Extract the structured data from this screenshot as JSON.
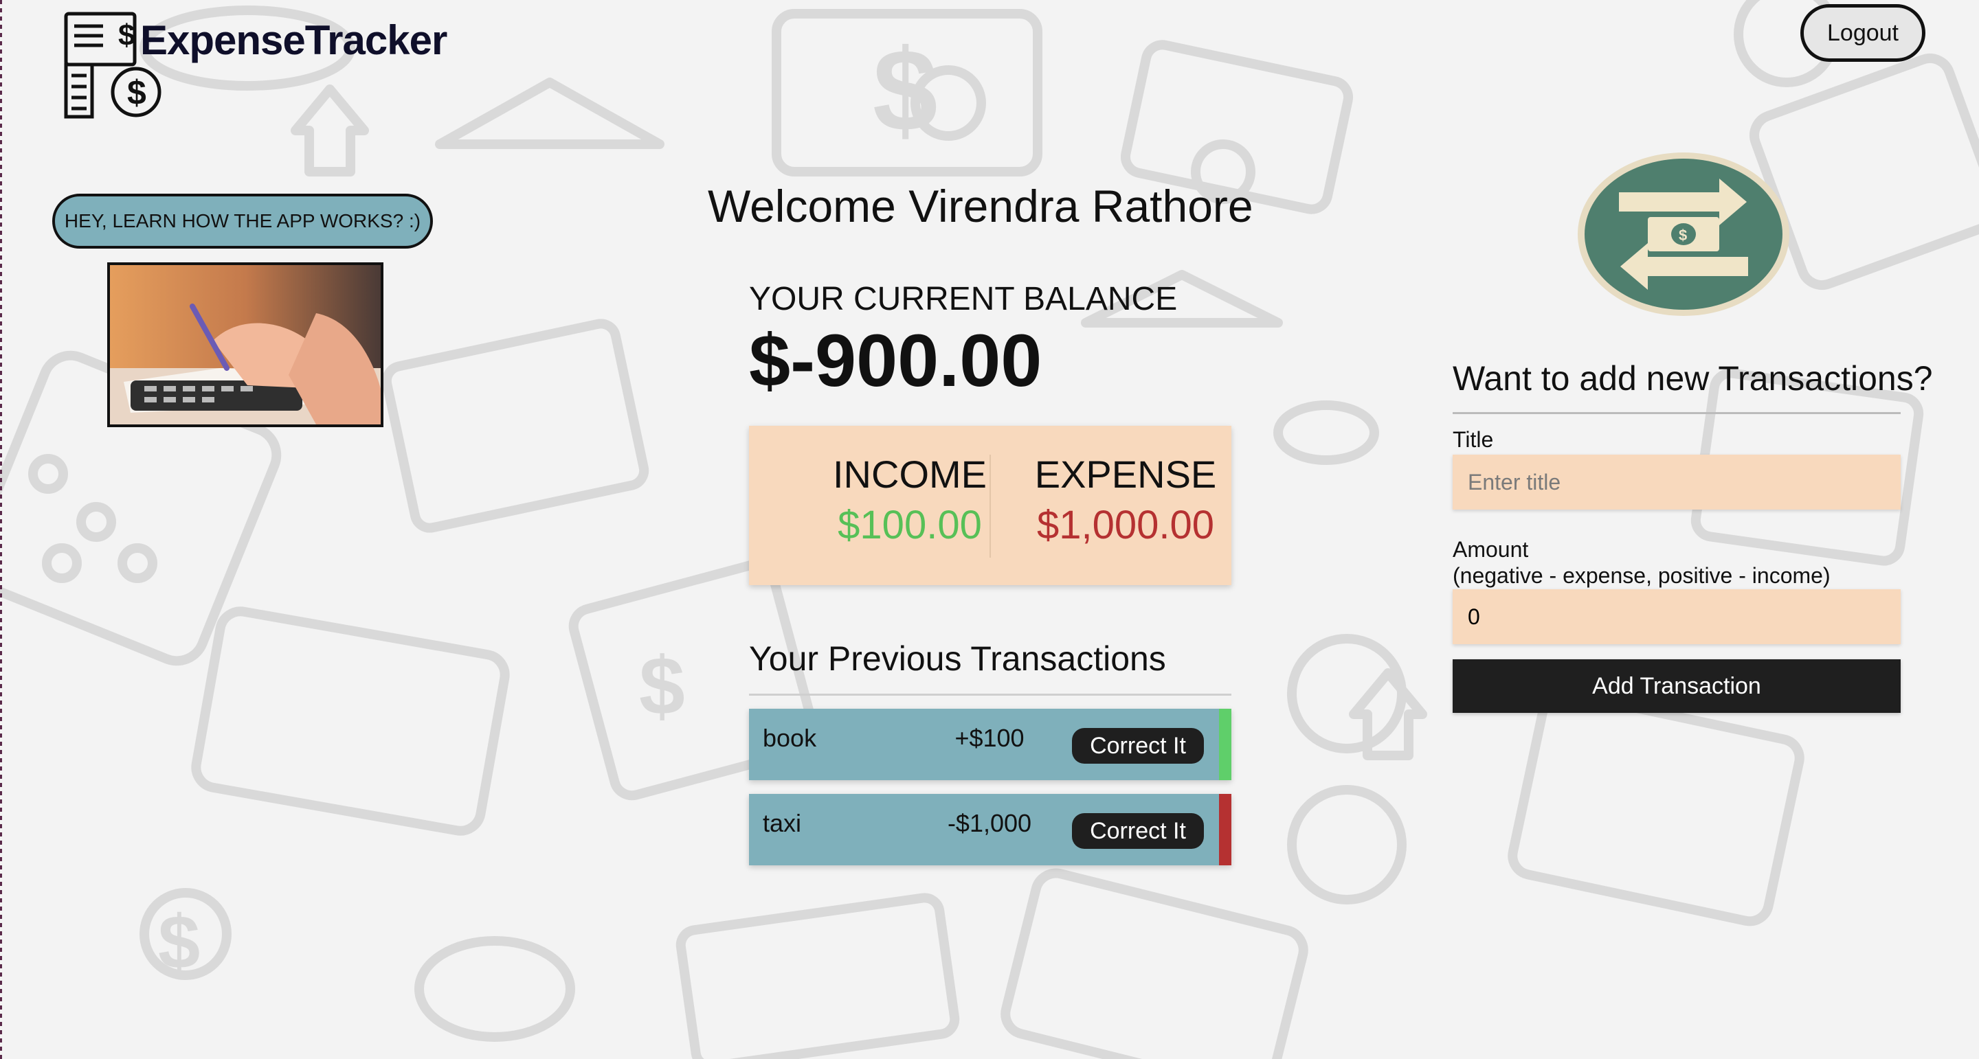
{
  "header": {
    "app_name": "ExpenseTracker",
    "logout_label": "Logout"
  },
  "sidebar": {
    "learn_label": "HEY, LEARN HOW THE APP WORKS? :)"
  },
  "main": {
    "welcome": "Welcome Virendra Rathore",
    "balance_label": "YOUR CURRENT BALANCE",
    "balance_value": "$-900.00",
    "income_label": "INCOME",
    "income_value": "$100.00",
    "expense_label": "EXPENSE",
    "expense_value": "$1,000.00",
    "previous_title": "Your Previous Transactions",
    "transactions": [
      {
        "title": "book",
        "amount": "+$100",
        "action": "Correct It",
        "status_color": "#5fcf6a"
      },
      {
        "title": "taxi",
        "amount": "-$1,000",
        "action": "Correct It",
        "status_color": "#b53131"
      }
    ]
  },
  "form": {
    "title": "Want to add new Transactions?",
    "title_label": "Title",
    "title_placeholder": "Enter title",
    "amount_label": "Amount",
    "amount_hint": "(negative - expense, positive - income)",
    "amount_value": "0",
    "submit_label": "Add Transaction"
  },
  "colors": {
    "accent_teal": "#7fb0bb",
    "card_peach": "#f8d9bd",
    "income_green": "#57c057",
    "expense_red": "#b53131",
    "button_dark": "#1f1f1f"
  },
  "icons": [
    "logo-icon",
    "exchange-money-icon",
    "calculator-photo"
  ]
}
